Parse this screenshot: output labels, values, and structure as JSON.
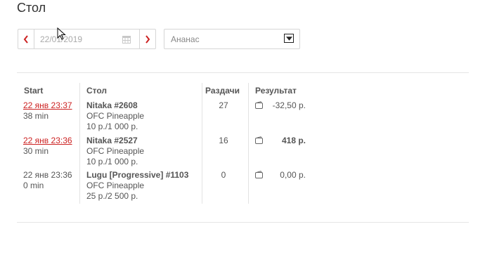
{
  "page": {
    "title": "Стол"
  },
  "filters": {
    "date_value": "22/01/2019",
    "select_value": "Ананас"
  },
  "table": {
    "headers": {
      "start": "Start",
      "table": "Стол",
      "hands": "Раздачи",
      "result": "Результат"
    },
    "rows": [
      {
        "date": "22 янв 23:37",
        "duration": "38 min",
        "name": "Nitaka #2608",
        "game": "OFC Pineapple",
        "stakes": "10 р./1 000 р.",
        "hands": "27",
        "result": "-32,50 р."
      },
      {
        "date": "22 янв 23:36",
        "duration": "30 min",
        "name": "Nitaka #2527",
        "game": "OFC Pineapple",
        "stakes": "10 р./1 000 р.",
        "hands": "16",
        "result": "418 р."
      },
      {
        "date": "22 янв 23:36",
        "duration": "0 min",
        "name": "Lugu [Progressive] #1103",
        "game": "OFC Pineapple",
        "stakes": "25 р./2 500 р.",
        "hands": "0",
        "result": "0,00 р."
      }
    ]
  },
  "colors": {
    "accent": "#cc2222",
    "divider": "#e5e5e5"
  }
}
